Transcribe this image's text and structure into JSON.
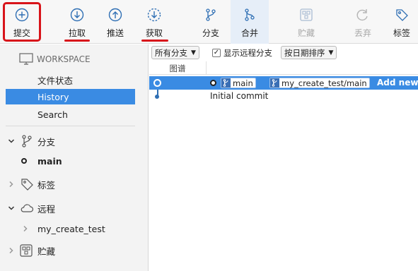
{
  "toolbar": {
    "commit": "提交",
    "pull": "拉取",
    "push": "推送",
    "fetch": "获取",
    "branch": "分支",
    "merge": "合并",
    "stash": "贮藏",
    "discard": "丢弃",
    "tag": "标签"
  },
  "sidebar": {
    "workspace_header": "WORKSPACE",
    "file_status": "文件状态",
    "history": "History",
    "search": "Search",
    "branches_header": "分支",
    "branch_main": "main",
    "tags_header": "标签",
    "remotes_header": "远程",
    "remote_name": "my_create_test",
    "stashes_header": "贮藏"
  },
  "filters": {
    "all_branches": "所有分支",
    "show_remote": "显示远程分支",
    "sort_by_date": "按日期排序"
  },
  "history": {
    "graph_header": "图谱",
    "commits": [
      {
        "tags": [
          "main",
          "my_create_test/main"
        ],
        "message": "Add new"
      },
      {
        "tags": [],
        "message": "Initial commit"
      }
    ]
  },
  "colors": {
    "accent": "#3a8be3",
    "annotation_red": "#d8141a",
    "toolbar_icon": "#2f6fb4"
  }
}
